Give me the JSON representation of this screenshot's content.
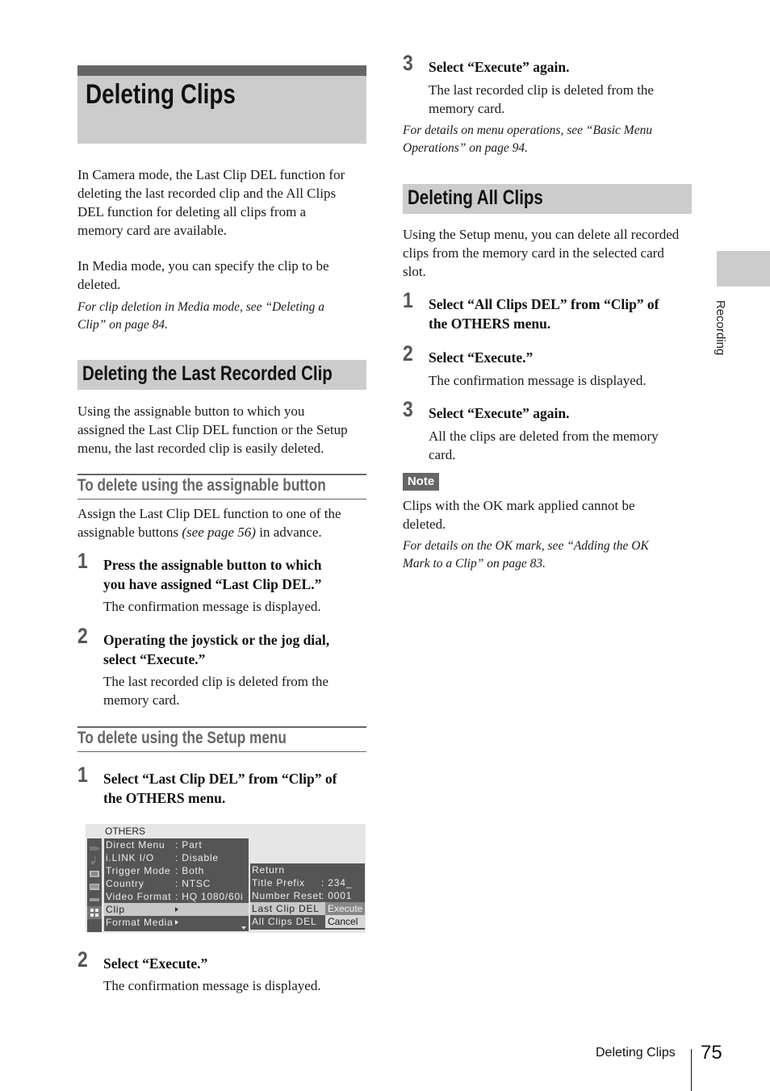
{
  "page_title": "Deleting Clips",
  "intro": {
    "p1": [
      "In Camera mode, the Last Clip DEL function for",
      "deleting the last recorded clip and the All Clips",
      "DEL function for deleting all clips from a",
      "memory card are available."
    ],
    "p2": [
      "In Media mode, you can specify the clip to be",
      "deleted."
    ],
    "ref": [
      "For clip deletion in Media mode, see “Deleting a",
      "Clip” on page 84."
    ]
  },
  "section_last": {
    "title": "Deleting the Last Recorded Clip",
    "body": [
      "Using the assignable button to which you",
      "assigned the Last Clip DEL function or the Setup",
      "menu, the last recorded clip is easily deleted."
    ],
    "sub_button": {
      "title": "To delete using the assignable button",
      "body_line1": "Assign the Last Clip DEL function to one of the",
      "body_line2_pre": "assignable buttons ",
      "body_line2_ital": "(see page 56)",
      "body_line2_post": " in advance.",
      "steps": [
        {
          "num": "1",
          "head": [
            "Press the assignable button to which",
            "you have assigned “Last Clip DEL.”"
          ],
          "body": [
            "The confirmation message is displayed."
          ]
        },
        {
          "num": "2",
          "head": [
            "Operating the joystick or the jog dial,",
            "select “Execute.”"
          ],
          "body": [
            "The last recorded clip is deleted from the",
            "memory card."
          ]
        }
      ]
    },
    "sub_setup": {
      "title": "To delete using the Setup menu",
      "steps": [
        {
          "num": "1",
          "head": [
            "Select “Last Clip DEL” from “Clip” of",
            "the OTHERS menu."
          ]
        },
        {
          "num": "2",
          "head": [
            "Select “Execute.”"
          ],
          "body": [
            "The confirmation message is displayed."
          ]
        },
        {
          "num": "3",
          "head": [
            "Select “Execute” again."
          ],
          "body": [
            "The last recorded clip is deleted from the",
            "memory card."
          ]
        }
      ],
      "ref": [
        "For details on menu operations, see “Basic Menu",
        "Operations” on page 94."
      ]
    }
  },
  "menu_screen": {
    "header": "OTHERS",
    "icons": [
      "camera-icon",
      "audio-icon",
      "video-icon",
      "lcd-icon",
      "timecode-icon",
      "others-icon"
    ],
    "items": [
      {
        "key": "Direct Menu",
        "value": ": Part"
      },
      {
        "key": "i.LINK I/O",
        "value": ": Disable"
      },
      {
        "key": "Trigger Mode",
        "value": ": Both"
      },
      {
        "key": "Country",
        "value": ": NTSC"
      },
      {
        "key": "Video Format",
        "value": ": HQ 1080/60i"
      },
      {
        "key": "Clip",
        "value": "",
        "selected": true
      },
      {
        "key": "Format Media",
        "value": ""
      }
    ],
    "submenu": [
      {
        "key": "Return",
        "value": ""
      },
      {
        "key": "Title Prefix",
        "value": ": 234_"
      },
      {
        "key": "Number Reset",
        "value": ": 0001"
      },
      {
        "key": "Last Clip DEL",
        "value": "",
        "selected": true
      },
      {
        "key": "All Clips DEL",
        "value": ""
      }
    ],
    "confirm": {
      "execute": "Execute",
      "cancel": "Cancel"
    }
  },
  "section_all": {
    "title": "Deleting All Clips",
    "body": [
      "Using the Setup menu, you can delete all recorded",
      "clips from the memory card in the selected card",
      "slot."
    ],
    "steps": [
      {
        "num": "1",
        "head": [
          "Select “All Clips DEL” from “Clip” of",
          "the OTHERS menu."
        ]
      },
      {
        "num": "2",
        "head": [
          "Select “Execute.”"
        ],
        "body": [
          "The confirmation message is displayed."
        ]
      },
      {
        "num": "3",
        "head": [
          "Select “Execute” again."
        ],
        "body": [
          "All the clips are deleted from the memory",
          "card."
        ]
      }
    ],
    "note": {
      "label": "Note",
      "body": [
        "Clips with the OK mark applied cannot be",
        "deleted."
      ],
      "ref": [
        "For details on the OK mark, see “Adding the OK",
        "Mark to a Clip” on page 83."
      ]
    }
  },
  "side_tab": "Recording",
  "footer": {
    "title": "Deleting Clips",
    "page": "75"
  }
}
